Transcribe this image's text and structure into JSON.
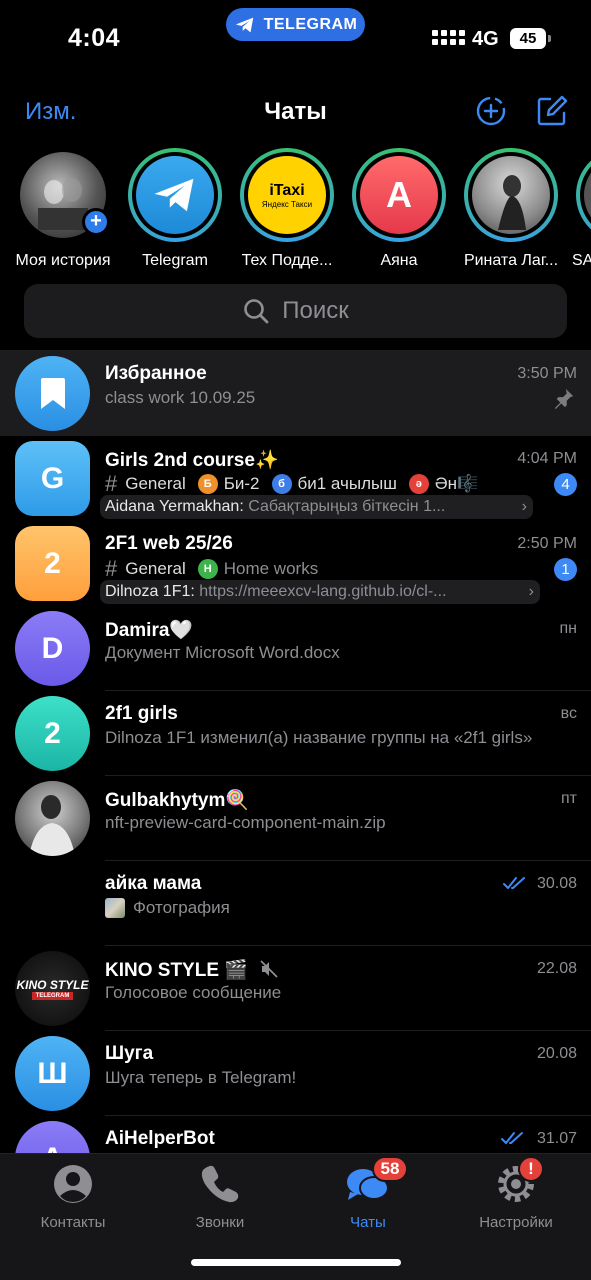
{
  "status_bar": {
    "time": "4:04",
    "pill_label": "TELEGRAM",
    "network": "4G",
    "battery": "45"
  },
  "header": {
    "edit_label": "Изм.",
    "title": "Чаты"
  },
  "stories": [
    {
      "label": "Моя история"
    },
    {
      "label": "Telegram"
    },
    {
      "label": "Тех Подде..."
    },
    {
      "label": "Аяна",
      "initial": "А"
    },
    {
      "label": "Рината Лаг..."
    },
    {
      "label": "SA"
    }
  ],
  "yandex_taxi": {
    "line1": "iTaxi",
    "line2": "Яндекс Такси"
  },
  "search": {
    "placeholder": "Поиск"
  },
  "chats": [
    {
      "name": "Избранное",
      "time": "3:50 PM",
      "message": "class work 10.09.25"
    },
    {
      "name": "Girls 2nd course✨",
      "initial": "G",
      "time": "4:04 PM",
      "unread": "4",
      "topics": [
        {
          "name": "General"
        },
        {
          "letter": "Б",
          "name": "Би-2",
          "color": "#f0902a"
        },
        {
          "letter": "б",
          "name": "би1 ачылыш",
          "color": "#3d7ee8"
        },
        {
          "letter": "ә",
          "name": "Ән🎼",
          "color": "#e5413b"
        }
      ],
      "sender": "Aidana Yermakhan:",
      "preview": "Сабақтарыңыз біткесін 1..."
    },
    {
      "name": "2F1 web 25/26",
      "initial": "2",
      "time": "2:50 PM",
      "unread": "1",
      "topics": [
        {
          "name": "General"
        },
        {
          "letter": "Н",
          "name": "Home works",
          "color": "#3cb44b"
        }
      ],
      "sender": "Dilnoza 1F1:",
      "preview": "https://meeexcv-lang.github.io/cl-..."
    },
    {
      "name": "Damira🤍",
      "initial": "D",
      "time": "пн",
      "message": "Документ Microsoft Word.docx"
    },
    {
      "name": "2f1 girls",
      "initial": "2",
      "time": "вс",
      "message": "Dilnoza 1F1 изменил(а) название группы на «2f1 girls»"
    },
    {
      "name": "Gulbakhytym🍭",
      "time": "пт",
      "message": "nft-preview-card-component-main.zip"
    },
    {
      "name": "айка мама",
      "time": "30.08",
      "message": "Фотография"
    },
    {
      "name": "KINO STYLE 🎬",
      "time": "22.08",
      "message": "Голосовое сообщение",
      "logo_text": "KINO STYLE",
      "logo_sub": "TELEGRAM"
    },
    {
      "name": "Шуга",
      "initial": "Ш",
      "time": "20.08",
      "message": "Шуга теперь в Telegram!"
    },
    {
      "name": "AiHelperBot",
      "initial": "A",
      "time": "31.07"
    }
  ],
  "tabbar": {
    "contacts": "Контакты",
    "calls": "Звонки",
    "chats": "Чаты",
    "chats_badge": "58",
    "settings": "Настройки",
    "settings_badge": "!"
  },
  "colors": {
    "accent": "#3d8af7",
    "badge": "#e5413b",
    "background": "#000000"
  }
}
